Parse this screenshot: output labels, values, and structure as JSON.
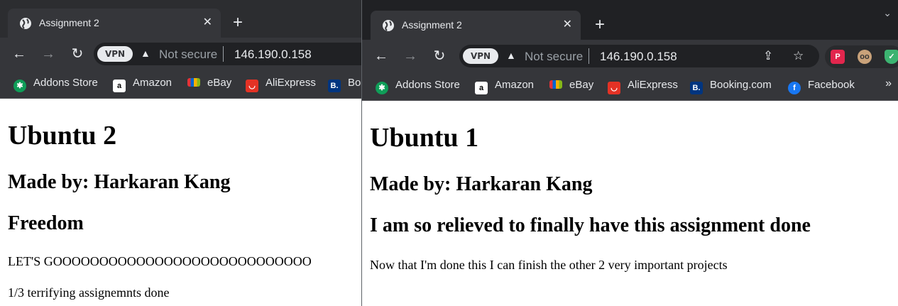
{
  "back_window": {
    "tab": {
      "title": "Assignment 2",
      "close": "✕"
    },
    "newtab": "+",
    "omnibox": {
      "vpn": "VPN",
      "security": "Not secure",
      "url": "146.190.0.158"
    },
    "bookmarks": [
      "Addons Store",
      "Amazon",
      "eBay",
      "AliExpress",
      "Bo"
    ],
    "page": {
      "heading": "Ubuntu 2",
      "made_by": "Made by: Harkaran Kang",
      "subheading": "Freedom",
      "line1": "LET'S GOOOOOOOOOOOOOOOOOOOOOOOOOOOO",
      "line2": "1/3 terrifying assignemnts done"
    }
  },
  "front_window": {
    "tab": {
      "title": "Assignment 2",
      "close": "✕"
    },
    "newtab": "+",
    "omnibox": {
      "vpn": "VPN",
      "security": "Not secure",
      "url": "146.190.0.158"
    },
    "bookmarks": [
      "Addons Store",
      "Amazon",
      "eBay",
      "AliExpress",
      "Booking.com",
      "Facebook"
    ],
    "bookmarks_more": "»",
    "page": {
      "heading": "Ubuntu 1",
      "made_by": "Made by: Harkaran Kang",
      "subheading": "I am so relieved to finally have this assignment done",
      "line1": "Now that I'm done this I can finish the other 2 very important projects"
    }
  },
  "colors": {
    "chrome_dark": "#202124",
    "chrome_toolbar": "#35363a",
    "page_bg": "#ffffff"
  }
}
